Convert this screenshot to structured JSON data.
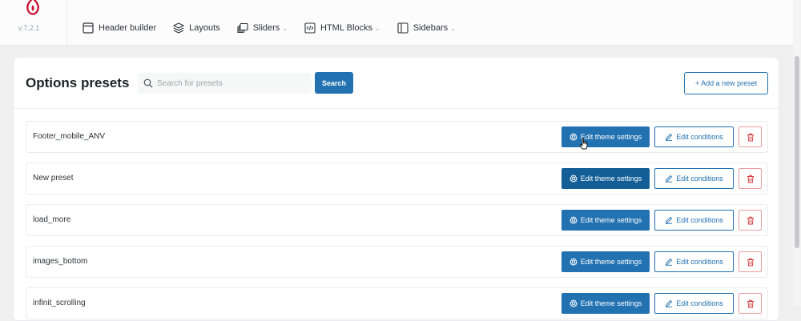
{
  "app": {
    "version": "v.7.2.1"
  },
  "nav": [
    {
      "label": "Header builder",
      "icon": "layout-icon",
      "dropdown": false
    },
    {
      "label": "Layouts",
      "icon": "layers-icon",
      "dropdown": false
    },
    {
      "label": "Sliders",
      "icon": "slides-icon",
      "dropdown": true
    },
    {
      "label": "HTML Blocks",
      "icon": "code-block-icon",
      "dropdown": true
    },
    {
      "label": "Sidebars",
      "icon": "sidebar-icon",
      "dropdown": true
    }
  ],
  "panel": {
    "title": "Options presets",
    "search_placeholder": "Search for presets",
    "search_button": "Search",
    "add_button": "+ Add a new preset"
  },
  "row_actions": {
    "edit_theme": "Edit theme settings",
    "edit_conditions": "Edit conditions"
  },
  "presets": [
    {
      "name": "Footer_mobile_ANV"
    },
    {
      "name": "New preset"
    },
    {
      "name": "load_more"
    },
    {
      "name": "images_bottom"
    },
    {
      "name": "infinit_scrolling"
    }
  ],
  "colors": {
    "primary": "#2271b1",
    "primary_active": "#135e96",
    "danger": "#d63638",
    "brand": "#c8102e"
  }
}
